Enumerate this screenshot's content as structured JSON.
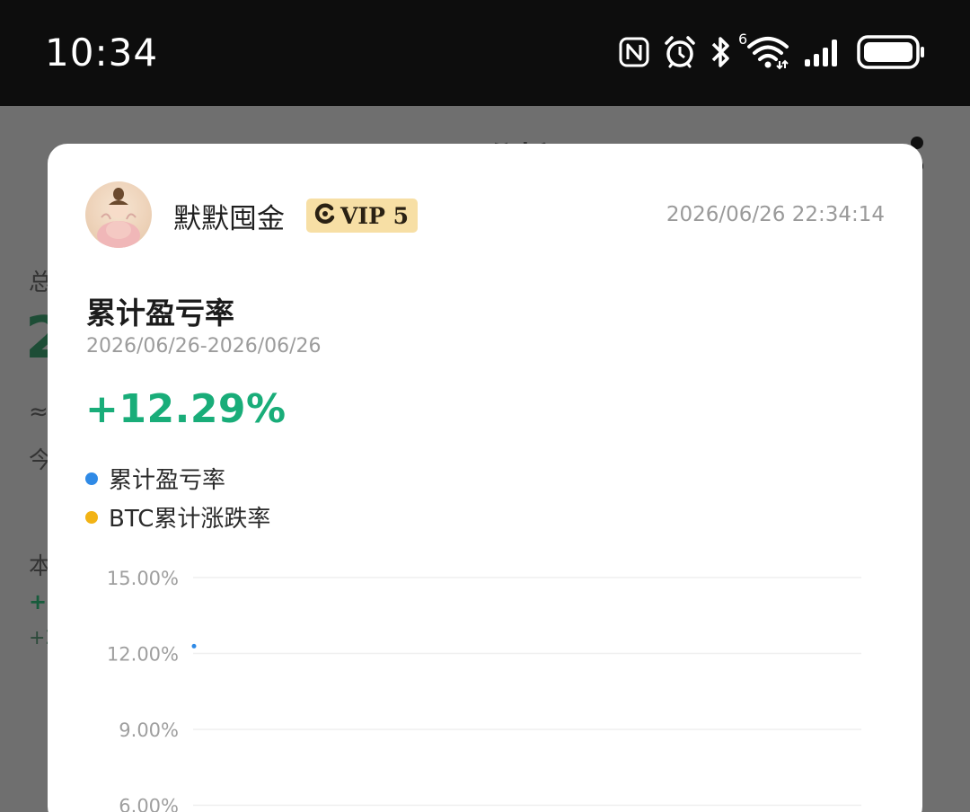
{
  "status_bar": {
    "time": "10:34",
    "icons": [
      "nfc-icon",
      "alarm-icon",
      "bluetooth-icon",
      "wifi-icon",
      "signal-icon",
      "battery-icon"
    ],
    "wifi_badge": "6"
  },
  "background": {
    "title": "盈亏分析"
  },
  "card": {
    "username": "默默囤金",
    "vip_label": "VIP 5",
    "timestamp": "2026/06/26 22:34:14",
    "section_title": "累计盈亏率",
    "date_range": "2026/06/26-2026/06/26",
    "pnl_value": "+12.29%",
    "legend": [
      {
        "label": "累计盈亏率",
        "color": "#2f8ae6"
      },
      {
        "label": "BTC累计涨跌率",
        "color": "#f2b315"
      }
    ]
  },
  "chart_data": {
    "type": "line",
    "y_tick_labels": [
      "15.00%",
      "12.00%",
      "9.00%",
      "6.00%"
    ],
    "y_ticks": [
      15,
      12,
      9,
      6
    ],
    "series": [
      {
        "name": "累计盈亏率",
        "color": "#2f8ae6",
        "points": [
          {
            "x": "2026/06/26",
            "y": 12.29
          }
        ]
      }
    ]
  }
}
